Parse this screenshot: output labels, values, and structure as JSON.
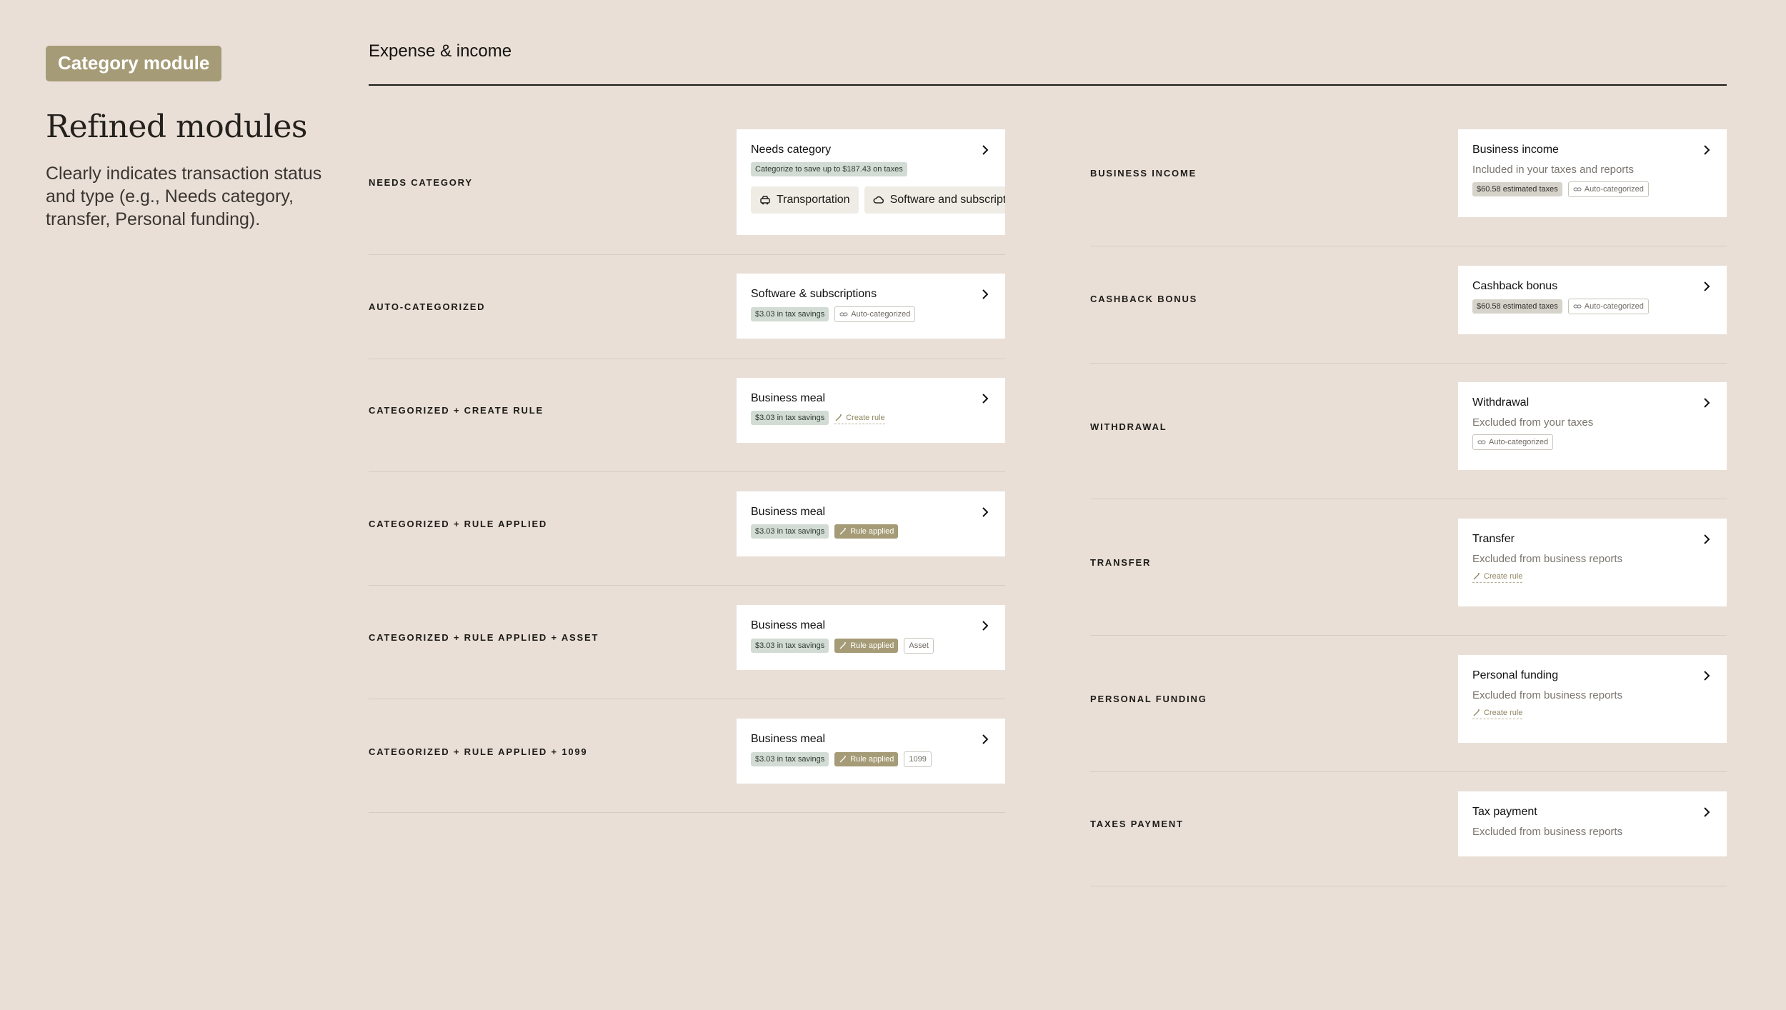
{
  "intro": {
    "badge": "Category module",
    "heading": "Refined modules",
    "description": "Clearly indicates transaction status and type (e.g., Needs category, transfer, Personal funding)."
  },
  "section": {
    "title": "Expense & income"
  },
  "left": [
    {
      "label": "NEEDS CATEGORY",
      "card": {
        "title": "Needs category",
        "note": "Categorize to save up to $187.43 on taxes",
        "chips": [
          "Transportation",
          "Software and subscriptions"
        ]
      }
    },
    {
      "label": "AUTO-CATEGORIZED",
      "card": {
        "title": "Software & subscriptions",
        "tag1": "$3.03 in tax savings",
        "tag2": "Auto-categorized"
      }
    },
    {
      "label": "CATEGORIZED + CREATE RULE",
      "card": {
        "title": "Business meal",
        "tag1": "$3.03 in tax savings",
        "tag2": "Create rule"
      }
    },
    {
      "label": "CATEGORIZED + RULE APPLIED",
      "card": {
        "title": "Business meal",
        "tag1": "$3.03 in tax savings",
        "tag2": "Rule applied"
      }
    },
    {
      "label": "CATEGORIZED + RULE APPLIED + ASSET",
      "card": {
        "title": "Business meal",
        "tag1": "$3.03 in tax savings",
        "tag2": "Rule applied",
        "tag3": "Asset"
      }
    },
    {
      "label": "CATEGORIZED + RULE APPLIED + 1099",
      "card": {
        "title": "Business meal",
        "tag1": "$3.03 in tax savings",
        "tag2": "Rule applied",
        "tag3": "1099"
      }
    }
  ],
  "right": [
    {
      "label": "BUSINESS INCOME",
      "card": {
        "title": "Business income",
        "subtitle": "Included in your taxes and reports",
        "tag1": "$60.58 estimated taxes",
        "tag2": "Auto-categorized"
      }
    },
    {
      "label": "CASHBACK BONUS",
      "card": {
        "title": "Cashback bonus",
        "tag1": "$60.58 estimated taxes",
        "tag2": "Auto-categorized"
      }
    },
    {
      "label": "WITHDRAWAL",
      "card": {
        "title": "Withdrawal",
        "subtitle": "Excluded from your taxes",
        "tag2": "Auto-categorized"
      }
    },
    {
      "label": "TRANSFER",
      "card": {
        "title": "Transfer",
        "subtitle": "Excluded from business reports",
        "tag2": "Create rule"
      }
    },
    {
      "label": "PERSONAL FUNDING",
      "card": {
        "title": "Personal funding",
        "subtitle": "Excluded from business reports",
        "tag2": "Create rule"
      }
    },
    {
      "label": "TAXES PAYMENT",
      "card": {
        "title": "Tax payment",
        "subtitle": "Excluded from business reports"
      }
    }
  ]
}
